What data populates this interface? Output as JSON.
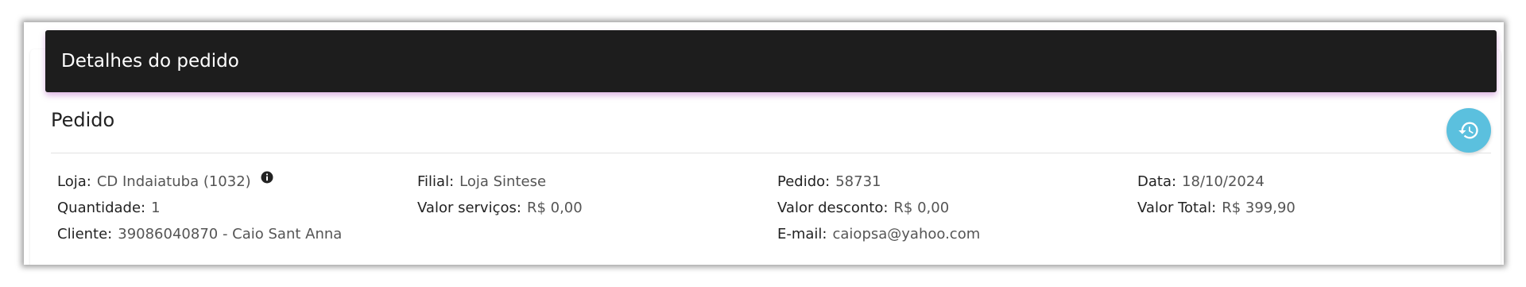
{
  "header": {
    "title": "Detalhes do pedido"
  },
  "section": {
    "title": "Pedido"
  },
  "history_button": {
    "icon": "history-icon",
    "color": "#5bc0de"
  },
  "fields": {
    "loja": {
      "label": "Loja:",
      "value": "CD Indaiatuba (1032)"
    },
    "filial": {
      "label": "Filial:",
      "value": "Loja Sintese"
    },
    "pedido": {
      "label": "Pedido:",
      "value": "58731"
    },
    "data": {
      "label": "Data:",
      "value": "18/10/2024"
    },
    "quantidade": {
      "label": "Quantidade:",
      "value": "1"
    },
    "valor_servicos": {
      "label": "Valor serviços:",
      "value": "R$ 0,00"
    },
    "valor_desconto": {
      "label": "Valor desconto:",
      "value": "R$ 0,00"
    },
    "valor_total": {
      "label": "Valor Total:",
      "value": "R$ 399,90"
    },
    "cliente": {
      "label": "Cliente:",
      "value": "39086040870 - Caio Sant Anna"
    },
    "email": {
      "label": "E-mail:",
      "value": "caiopsa@yahoo.com"
    }
  },
  "colors": {
    "header_bg": "#1d1d1d",
    "header_glow": "#9c27b0",
    "accent": "#5bc0de"
  }
}
